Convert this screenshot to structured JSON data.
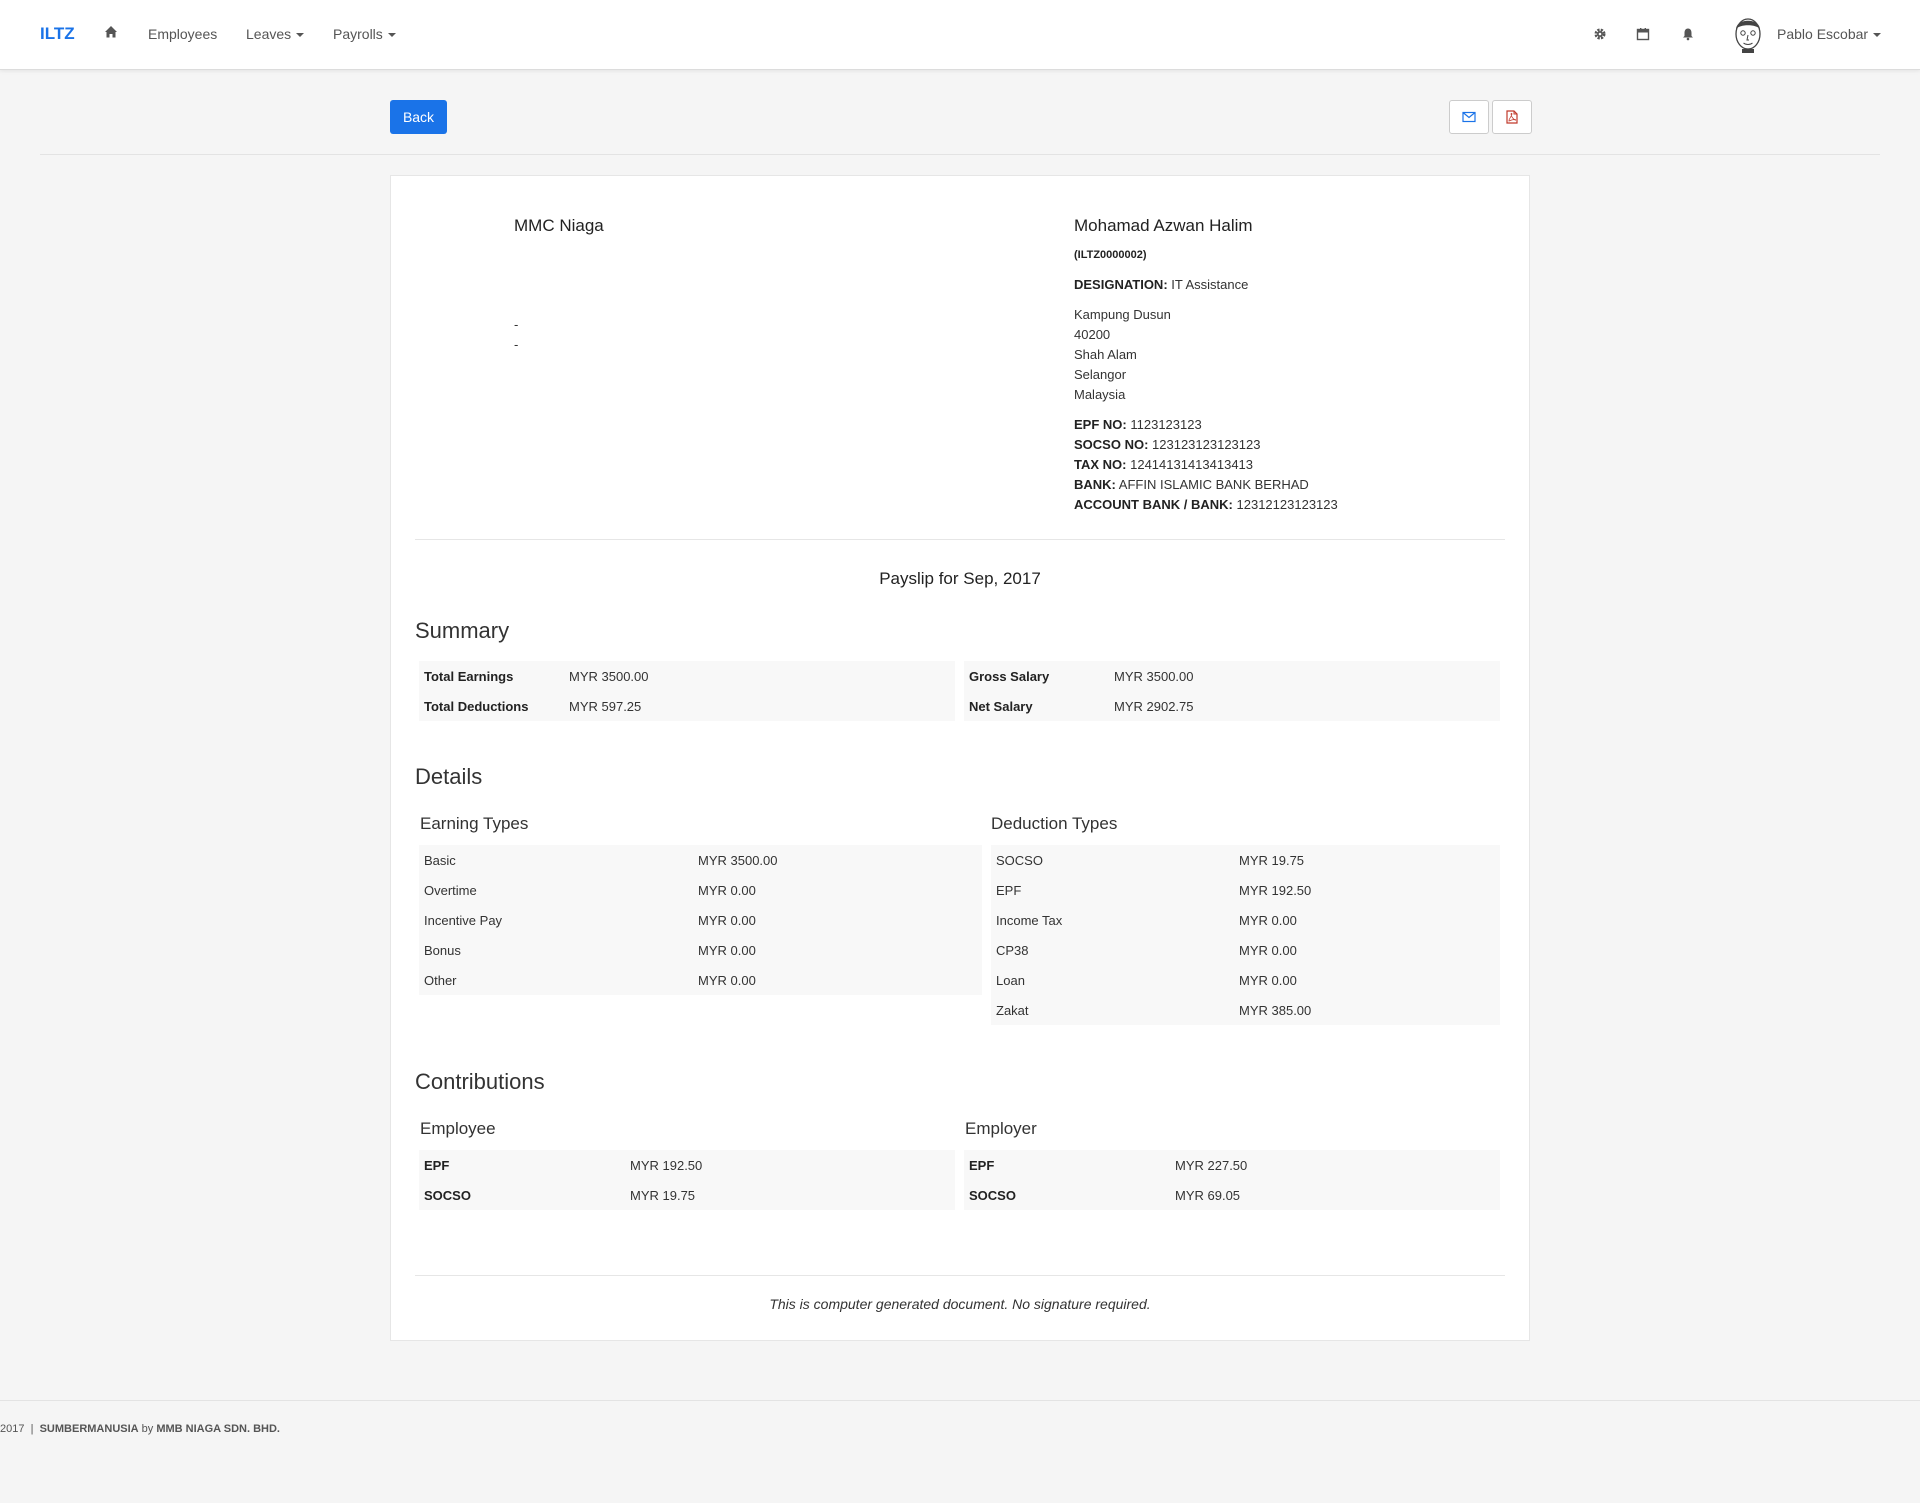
{
  "navbar": {
    "brand": "ILTZ",
    "links": {
      "employees": "Employees",
      "leaves": "Leaves",
      "payrolls": "Payrolls"
    },
    "user_name": "Pablo Escobar"
  },
  "actions": {
    "back_label": "Back"
  },
  "company": {
    "name": "MMC Niaga",
    "lines": [
      "-",
      "-"
    ]
  },
  "employee": {
    "name": "Mohamad Azwan Halim",
    "id": "(ILTZ0000002)",
    "designation_label": "DESIGNATION:",
    "designation": "IT Assistance",
    "address": [
      "Kampung Dusun",
      "40200",
      "Shah Alam",
      "Selangor",
      "Malaysia"
    ],
    "details": [
      {
        "label": "EPF NO:",
        "value": "1123123123"
      },
      {
        "label": "SOCSO NO:",
        "value": "123123123123123"
      },
      {
        "label": "TAX NO:",
        "value": "12414131413413413"
      },
      {
        "label": "BANK:",
        "value": "AFFIN ISLAMIC BANK BERHAD"
      },
      {
        "label": "ACCOUNT BANK / BANK:",
        "value": "12312123123123"
      }
    ]
  },
  "payslip_title": "Payslip for Sep, 2017",
  "summary": {
    "heading": "Summary",
    "left": [
      {
        "label": "Total Earnings",
        "value": "MYR 3500.00"
      },
      {
        "label": "Total Deductions",
        "value": "MYR 597.25"
      }
    ],
    "right": [
      {
        "label": "Gross Salary",
        "value": "MYR 3500.00"
      },
      {
        "label": "Net Salary",
        "value": "MYR 2902.75"
      }
    ]
  },
  "details": {
    "heading": "Details",
    "earnings_heading": "Earning Types",
    "earnings": [
      {
        "label": "Basic",
        "value": "MYR 3500.00"
      },
      {
        "label": "Overtime",
        "value": "MYR 0.00"
      },
      {
        "label": "Incentive Pay",
        "value": "MYR 0.00"
      },
      {
        "label": "Bonus",
        "value": "MYR 0.00"
      },
      {
        "label": "Other",
        "value": "MYR 0.00"
      }
    ],
    "deductions_heading": "Deduction Types",
    "deductions": [
      {
        "label": "SOCSO",
        "value": "MYR 19.75"
      },
      {
        "label": "EPF",
        "value": "MYR 192.50"
      },
      {
        "label": "Income Tax",
        "value": "MYR 0.00"
      },
      {
        "label": "CP38",
        "value": "MYR 0.00"
      },
      {
        "label": "Loan",
        "value": "MYR 0.00"
      },
      {
        "label": "Zakat",
        "value": "MYR 385.00"
      }
    ]
  },
  "contributions": {
    "heading": "Contributions",
    "employee_heading": "Employee",
    "employee": [
      {
        "label": "EPF",
        "value": "MYR 192.50"
      },
      {
        "label": "SOCSO",
        "value": "MYR 19.75"
      }
    ],
    "employer_heading": "Employer",
    "employer": [
      {
        "label": "EPF",
        "value": "MYR 227.50"
      },
      {
        "label": "SOCSO",
        "value": "MYR 69.05"
      }
    ]
  },
  "note": "This is computer generated document. No signature required.",
  "footer": {
    "year": "2017",
    "separator": "|",
    "brand": "SUMBERMANUSIA",
    "by": "by",
    "company": "MMB NIAGA SDN. BHD."
  },
  "colors": {
    "accent": "#1a73e8",
    "pdf_icon": "#c0392b"
  }
}
